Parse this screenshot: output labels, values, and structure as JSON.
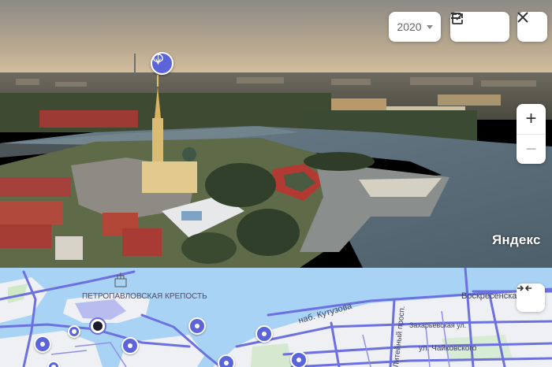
{
  "panorama": {
    "year": "2020",
    "logo": "Яндекс"
  },
  "controls": {
    "year_select_icon": "caret-down-icon",
    "open_external_icon": "external-link-icon",
    "menu_icon": "equals-icon",
    "close_icon": "close-icon",
    "zoom_in": "+",
    "zoom_out": "−",
    "collapse_icon": "collapse-arrows-icon"
  },
  "map": {
    "fortress_label": "ПЕТРОПАВЛОВСКАЯ КРЕПОСТЬ",
    "streets": {
      "kutuzova": "наб. Кутузова",
      "liteyny": "Литейный просп.",
      "voskresenskaya": "Воскресенская",
      "zakharyevskaya": "Захарьевская ул.",
      "chaykovskogo": "ул. Чайковского"
    }
  },
  "colors": {
    "accent": "#5b64d9",
    "water": "#a8d3f5",
    "road": "#6d70e0"
  }
}
